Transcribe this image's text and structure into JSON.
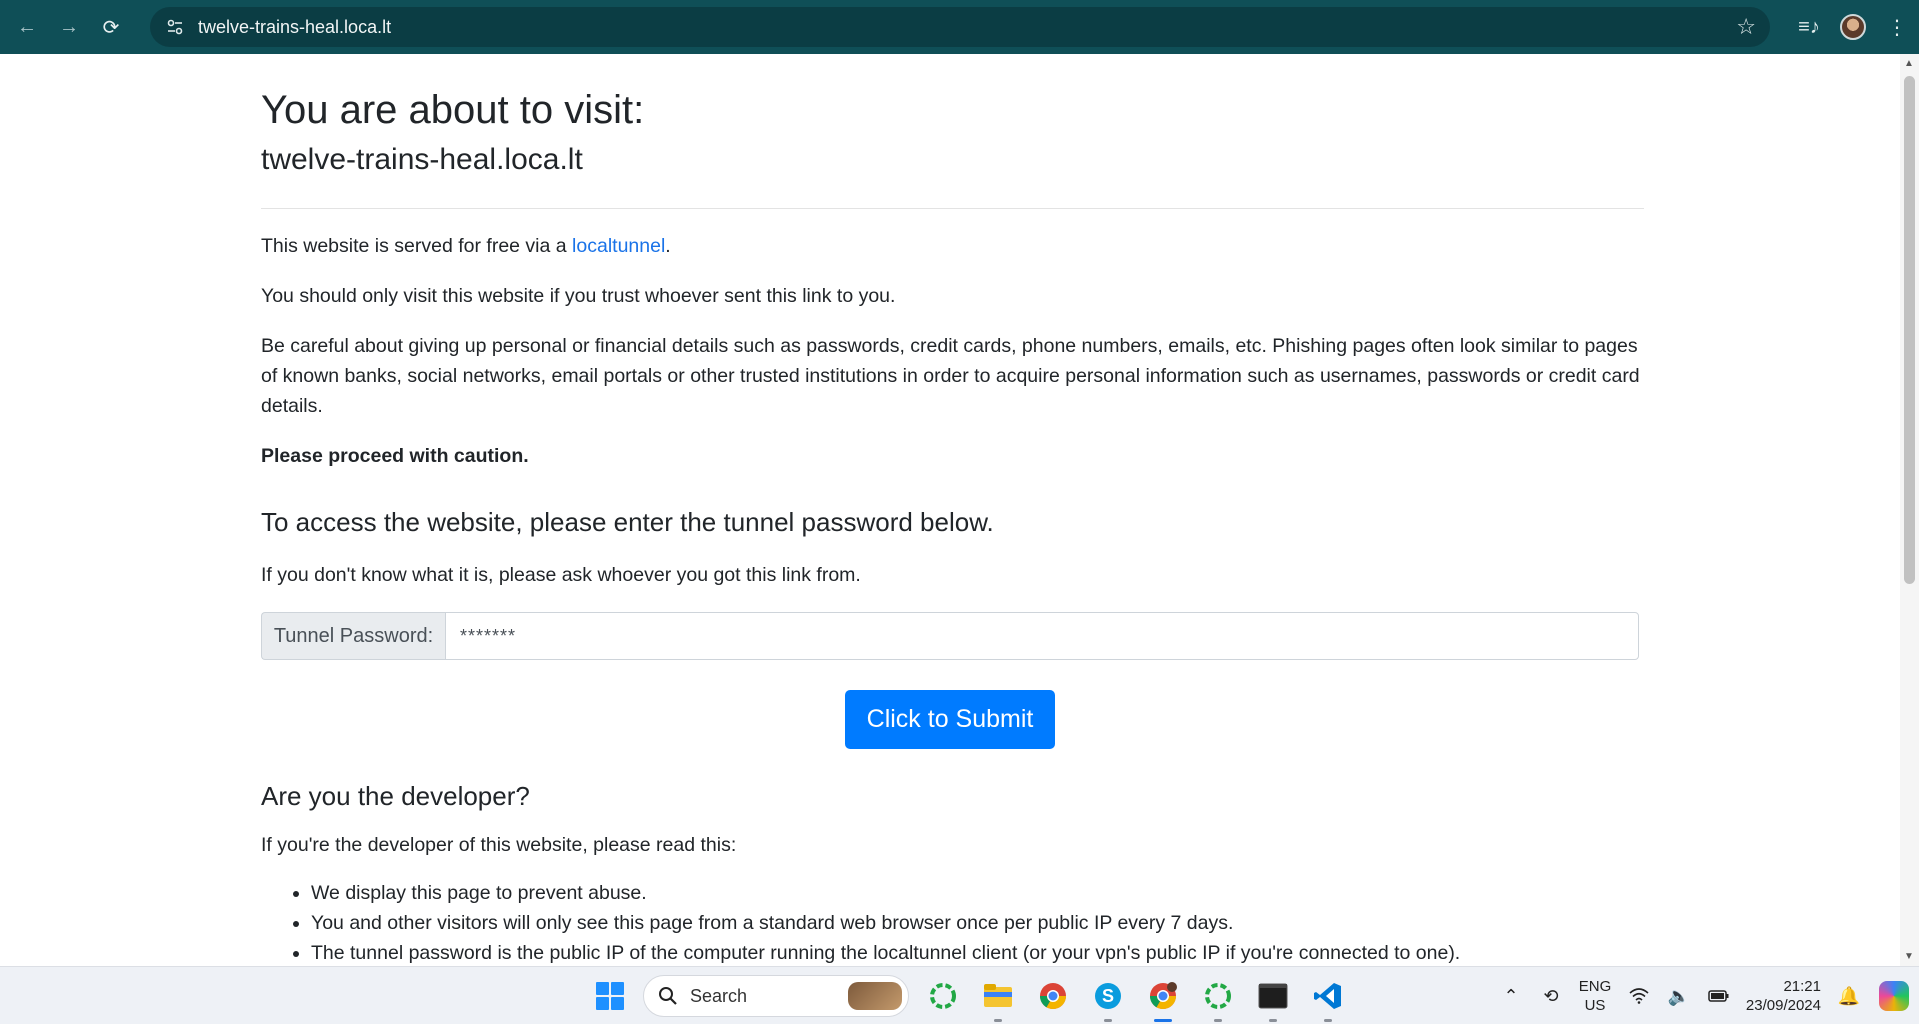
{
  "browser": {
    "url": "twelve-trains-heal.loca.lt",
    "icons": [
      "back-icon",
      "forward-icon",
      "reload-icon",
      "site-info-icon",
      "bookmark-star-icon",
      "media-control-icon",
      "profile-avatar",
      "more-menu-icon"
    ]
  },
  "page": {
    "title": "You are about to visit:",
    "host": "twelve-trains-heal.loca.lt",
    "p1_prefix": "This website is served for free via a ",
    "p1_link": "localtunnel",
    "p1_suffix": ".",
    "p2": "You should only visit this website if you trust whoever sent this link to you.",
    "p3": "Be careful about giving up personal or financial details such as passwords, credit cards, phone numbers, emails, etc. Phishing pages often look similar to pages of known banks, social networks, email portals or other trusted institutions in order to acquire personal information such as usernames, passwords or credit card details.",
    "p4": "Please proceed with caution.",
    "access_heading": "To access the website, please enter the tunnel password below.",
    "access_help": "If you don't know what it is, please ask whoever you got this link from.",
    "password_label": "Tunnel Password:",
    "password_value": "*******",
    "submit_label": "Click to Submit",
    "dev_heading": "Are you the developer?",
    "dev_intro": "If you're the developer of this website, please read this:",
    "dev_items": [
      "We display this page to prevent abuse.",
      "You and other visitors will only see this page from a standard web browser once per public IP every 7 days.",
      "The tunnel password is the public IP of the computer running the localtunnel client (or your vpn's public IP if you're connected to one)."
    ]
  },
  "taskbar": {
    "search_label": "Search",
    "lang_top": "ENG",
    "lang_bottom": "US",
    "time": "21:21",
    "date": "23/09/2024",
    "accent": "#1a73e8"
  }
}
